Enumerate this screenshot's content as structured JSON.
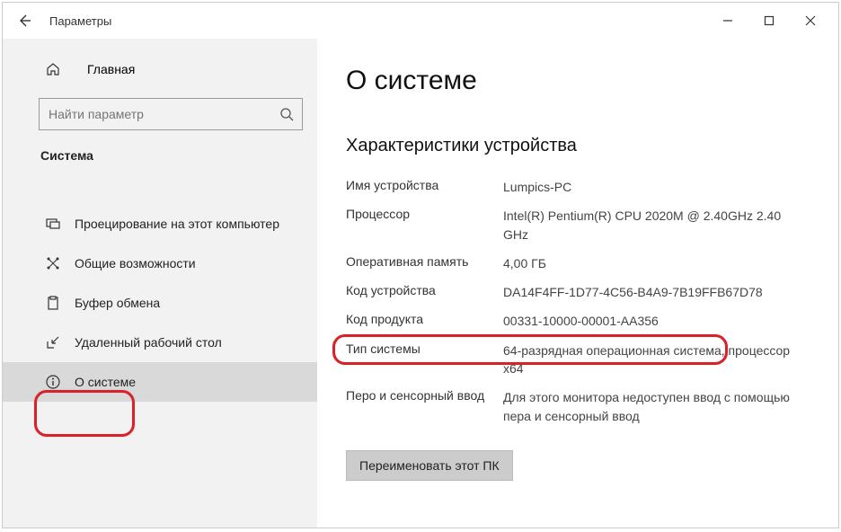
{
  "window": {
    "title": "Параметры"
  },
  "sidebar": {
    "home": "Главная",
    "search_placeholder": "Найти параметр",
    "section": "Система",
    "items": [
      {
        "label": "Проецирование на этот компьютер"
      },
      {
        "label": "Общие возможности"
      },
      {
        "label": "Буфер обмена"
      },
      {
        "label": "Удаленный рабочий стол"
      },
      {
        "label": "О системе"
      }
    ]
  },
  "main": {
    "heading": "О системе",
    "subheading": "Характеристики устройства",
    "specs": [
      {
        "label": "Имя устройства",
        "value": "Lumpics-PC"
      },
      {
        "label": "Процессор",
        "value": "Intel(R) Pentium(R) CPU 2020M @ 2.40GHz 2.40 GHz"
      },
      {
        "label": "Оперативная память",
        "value": "4,00 ГБ"
      },
      {
        "label": "Код устройства",
        "value": "DA14F4FF-1D77-4C56-B4A9-7B19FFB67D78"
      },
      {
        "label": "Код продукта",
        "value": "00331-10000-00001-AA356"
      },
      {
        "label": "Тип системы",
        "value": "64-разрядная операционная система, процессор x64"
      },
      {
        "label": "Перо и сенсорный ввод",
        "value": "Для этого монитора недоступен ввод с помощью пера и сенсорный ввод"
      }
    ],
    "rename_button": "Переименовать этот ПК"
  }
}
